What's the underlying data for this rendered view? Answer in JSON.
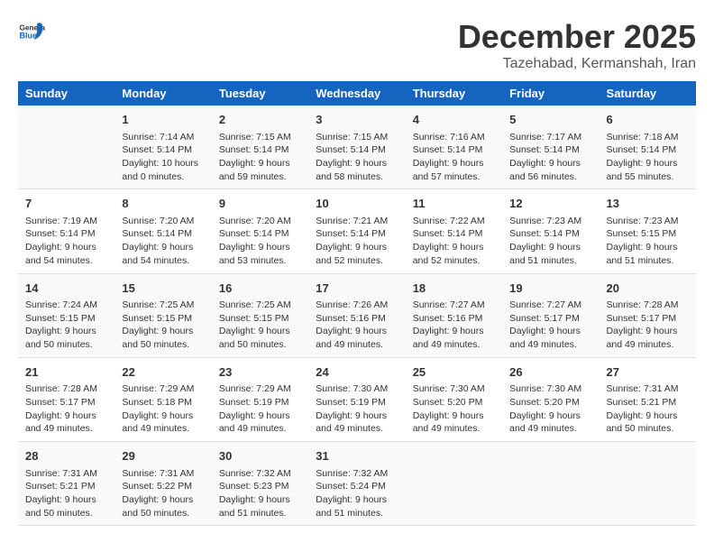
{
  "logo": {
    "text_general": "General",
    "text_blue": "Blue"
  },
  "title": "December 2025",
  "location": "Tazehabad, Kermanshah, Iran",
  "headers": [
    "Sunday",
    "Monday",
    "Tuesday",
    "Wednesday",
    "Thursday",
    "Friday",
    "Saturday"
  ],
  "weeks": [
    [
      {
        "day": "",
        "info": ""
      },
      {
        "day": "1",
        "info": "Sunrise: 7:14 AM\nSunset: 5:14 PM\nDaylight: 10 hours\nand 0 minutes."
      },
      {
        "day": "2",
        "info": "Sunrise: 7:15 AM\nSunset: 5:14 PM\nDaylight: 9 hours\nand 59 minutes."
      },
      {
        "day": "3",
        "info": "Sunrise: 7:15 AM\nSunset: 5:14 PM\nDaylight: 9 hours\nand 58 minutes."
      },
      {
        "day": "4",
        "info": "Sunrise: 7:16 AM\nSunset: 5:14 PM\nDaylight: 9 hours\nand 57 minutes."
      },
      {
        "day": "5",
        "info": "Sunrise: 7:17 AM\nSunset: 5:14 PM\nDaylight: 9 hours\nand 56 minutes."
      },
      {
        "day": "6",
        "info": "Sunrise: 7:18 AM\nSunset: 5:14 PM\nDaylight: 9 hours\nand 55 minutes."
      }
    ],
    [
      {
        "day": "7",
        "info": "Sunrise: 7:19 AM\nSunset: 5:14 PM\nDaylight: 9 hours\nand 54 minutes."
      },
      {
        "day": "8",
        "info": "Sunrise: 7:20 AM\nSunset: 5:14 PM\nDaylight: 9 hours\nand 54 minutes."
      },
      {
        "day": "9",
        "info": "Sunrise: 7:20 AM\nSunset: 5:14 PM\nDaylight: 9 hours\nand 53 minutes."
      },
      {
        "day": "10",
        "info": "Sunrise: 7:21 AM\nSunset: 5:14 PM\nDaylight: 9 hours\nand 52 minutes."
      },
      {
        "day": "11",
        "info": "Sunrise: 7:22 AM\nSunset: 5:14 PM\nDaylight: 9 hours\nand 52 minutes."
      },
      {
        "day": "12",
        "info": "Sunrise: 7:23 AM\nSunset: 5:14 PM\nDaylight: 9 hours\nand 51 minutes."
      },
      {
        "day": "13",
        "info": "Sunrise: 7:23 AM\nSunset: 5:15 PM\nDaylight: 9 hours\nand 51 minutes."
      }
    ],
    [
      {
        "day": "14",
        "info": "Sunrise: 7:24 AM\nSunset: 5:15 PM\nDaylight: 9 hours\nand 50 minutes."
      },
      {
        "day": "15",
        "info": "Sunrise: 7:25 AM\nSunset: 5:15 PM\nDaylight: 9 hours\nand 50 minutes."
      },
      {
        "day": "16",
        "info": "Sunrise: 7:25 AM\nSunset: 5:15 PM\nDaylight: 9 hours\nand 50 minutes."
      },
      {
        "day": "17",
        "info": "Sunrise: 7:26 AM\nSunset: 5:16 PM\nDaylight: 9 hours\nand 49 minutes."
      },
      {
        "day": "18",
        "info": "Sunrise: 7:27 AM\nSunset: 5:16 PM\nDaylight: 9 hours\nand 49 minutes."
      },
      {
        "day": "19",
        "info": "Sunrise: 7:27 AM\nSunset: 5:17 PM\nDaylight: 9 hours\nand 49 minutes."
      },
      {
        "day": "20",
        "info": "Sunrise: 7:28 AM\nSunset: 5:17 PM\nDaylight: 9 hours\nand 49 minutes."
      }
    ],
    [
      {
        "day": "21",
        "info": "Sunrise: 7:28 AM\nSunset: 5:17 PM\nDaylight: 9 hours\nand 49 minutes."
      },
      {
        "day": "22",
        "info": "Sunrise: 7:29 AM\nSunset: 5:18 PM\nDaylight: 9 hours\nand 49 minutes."
      },
      {
        "day": "23",
        "info": "Sunrise: 7:29 AM\nSunset: 5:19 PM\nDaylight: 9 hours\nand 49 minutes."
      },
      {
        "day": "24",
        "info": "Sunrise: 7:30 AM\nSunset: 5:19 PM\nDaylight: 9 hours\nand 49 minutes."
      },
      {
        "day": "25",
        "info": "Sunrise: 7:30 AM\nSunset: 5:20 PM\nDaylight: 9 hours\nand 49 minutes."
      },
      {
        "day": "26",
        "info": "Sunrise: 7:30 AM\nSunset: 5:20 PM\nDaylight: 9 hours\nand 49 minutes."
      },
      {
        "day": "27",
        "info": "Sunrise: 7:31 AM\nSunset: 5:21 PM\nDaylight: 9 hours\nand 50 minutes."
      }
    ],
    [
      {
        "day": "28",
        "info": "Sunrise: 7:31 AM\nSunset: 5:21 PM\nDaylight: 9 hours\nand 50 minutes."
      },
      {
        "day": "29",
        "info": "Sunrise: 7:31 AM\nSunset: 5:22 PM\nDaylight: 9 hours\nand 50 minutes."
      },
      {
        "day": "30",
        "info": "Sunrise: 7:32 AM\nSunset: 5:23 PM\nDaylight: 9 hours\nand 51 minutes."
      },
      {
        "day": "31",
        "info": "Sunrise: 7:32 AM\nSunset: 5:24 PM\nDaylight: 9 hours\nand 51 minutes."
      },
      {
        "day": "",
        "info": ""
      },
      {
        "day": "",
        "info": ""
      },
      {
        "day": "",
        "info": ""
      }
    ]
  ]
}
